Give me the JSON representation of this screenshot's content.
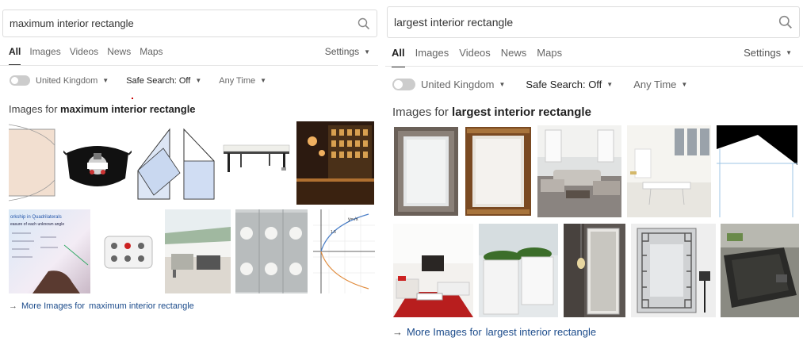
{
  "left": {
    "search": {
      "value": "maximum interior rectangle"
    },
    "tabs": [
      "All",
      "Images",
      "Videos",
      "News",
      "Maps"
    ],
    "settings_label": "Settings",
    "filters": {
      "region": "United Kingdom",
      "safe_search": "Safe Search: Off",
      "time": "Any Time"
    },
    "images_title_prefix": "Images for ",
    "images_title_query": "maximum interior rectangle",
    "more_images": {
      "prefix": "More Images for ",
      "query": "maximum interior rectangle"
    }
  },
  "right": {
    "search": {
      "value": "largest interior rectangle"
    },
    "tabs": [
      "All",
      "Images",
      "Videos",
      "News",
      "Maps"
    ],
    "settings_label": "Settings",
    "filters": {
      "region": "United Kingdom",
      "safe_search": "Safe Search: Off",
      "time": "Any Time"
    },
    "images_title_prefix": "Images for ",
    "images_title_query": "largest interior rectangle",
    "more_images": {
      "prefix": "More Images for ",
      "query": "largest interior rectangle"
    }
  },
  "thumb_text": {
    "worksheet_heading": "orkship in Quadrilaterals",
    "worksheet_sub": "easure of each unknown angle",
    "graph_formula": "y=√x",
    "graph_value": "1.5"
  },
  "icons": {
    "search": "search-icon",
    "more_arrow": "arrow-right-icon",
    "caret": "caret-down-icon"
  },
  "colors": {
    "link": "#1a4a8a",
    "toggle_off": "#cccccc",
    "divider": "#e5e5e5"
  }
}
